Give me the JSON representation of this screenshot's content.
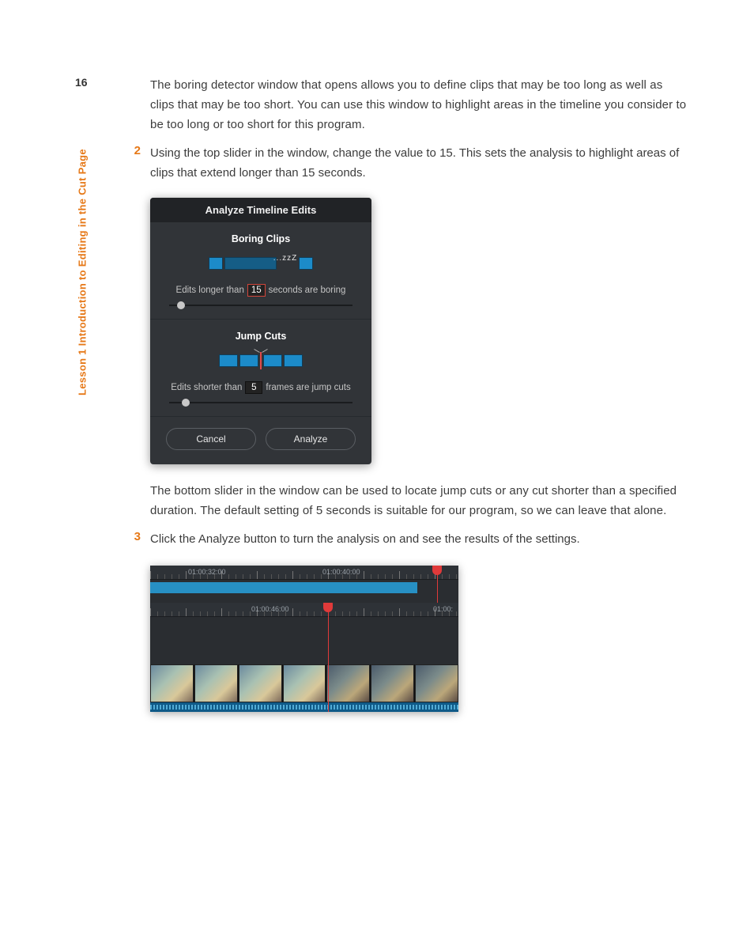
{
  "page": {
    "number": "16",
    "lesson_label": "Lesson 1     Introduction to Editing in the Cut Page"
  },
  "paragraphs": {
    "intro": "The boring detector window that opens allows you to define clips that may be too long as well as clips that may be too short. You can use this window to highlight areas in the timeline you consider to be too long or too short for this program.",
    "step2_num": "2",
    "step2": "Using the top slider in the window, change the value to 15. This sets the analysis to highlight areas of clips that extend longer than 15 seconds.",
    "after_dialog": "The bottom slider in the window can be used to locate jump cuts or any cut shorter than a specified duration. The default setting of 5 seconds is suitable for our program, so we can leave that alone.",
    "step3_num": "3",
    "step3": "Click the Analyze button to turn the analysis on and see the results of the settings."
  },
  "dialog": {
    "title": "Analyze Timeline Edits",
    "boring": {
      "title": "Boring Clips",
      "annotation": "...zzZ",
      "prefix": "Edits longer than",
      "value": "15",
      "suffix": "seconds are boring"
    },
    "jump": {
      "title": "Jump Cuts",
      "prefix": "Edits shorter than",
      "value": "5",
      "suffix": "frames are jump cuts"
    },
    "cancel": "Cancel",
    "analyze": "Analyze"
  },
  "timeline": {
    "upper_tc1": "01:00:32:00",
    "upper_tc2": "01:00:40:00",
    "lower_tc1": "01:00:46:00",
    "lower_tc2": "01:00:"
  }
}
